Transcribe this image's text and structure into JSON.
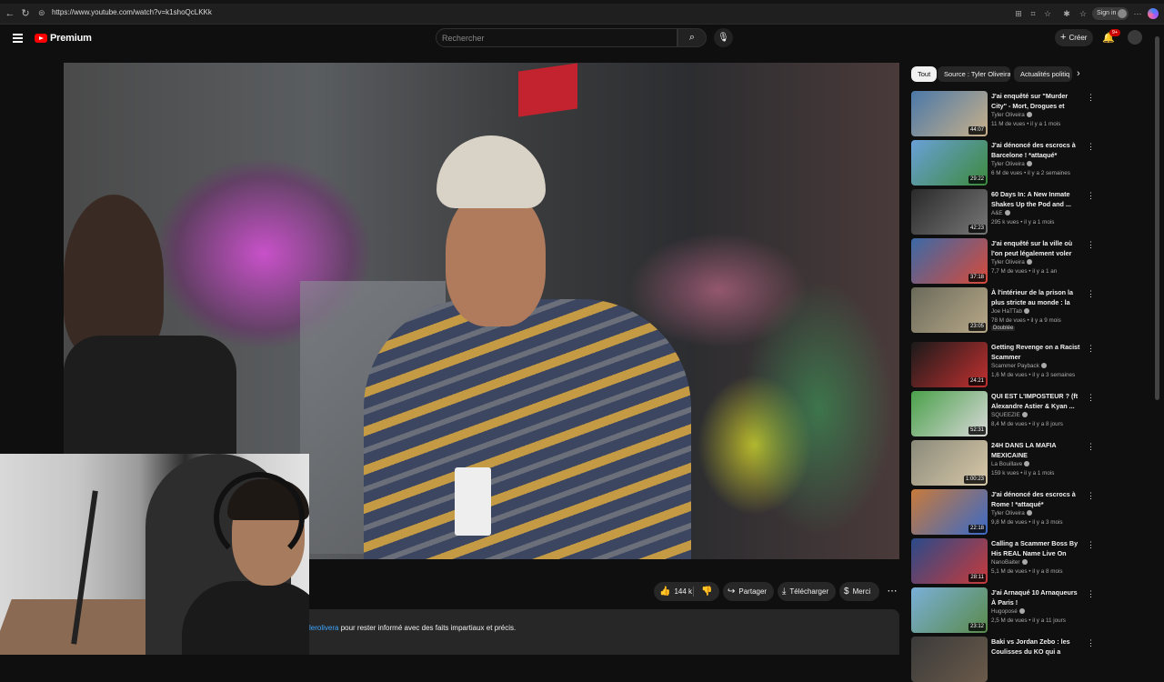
{
  "browser": {
    "url": "https://www.youtube.com/watch?v=k1shoQcLKKk",
    "signin_label": "Sign in"
  },
  "header": {
    "logo_text": "Premium",
    "search_placeholder": "Rechercher",
    "create_label": "Créer",
    "notification_count": "9+"
  },
  "actions": {
    "likes": "144 k",
    "share": "Partager",
    "download": "Télécharger",
    "thanks": "Merci"
  },
  "description": {
    "link": "lerolivera",
    "text": " pour rester informé avec des faits impartiaux et précis."
  },
  "chips": [
    {
      "label": "Tout"
    },
    {
      "label": "Source : Tyler Oliveira"
    },
    {
      "label": "Actualités politiq"
    }
  ],
  "recommendations": [
    {
      "title": "J'ai enquêté sur \"Murder City\" - Mort, Drogues et Tueurs en ...",
      "channel": "Tyler Oliveira",
      "meta": "11 M de vues • il y a 1 mois",
      "duration": "44:07",
      "color1": "#4a78a8",
      "color2": "#c8b08a"
    },
    {
      "title": "J'ai dénoncé des escrocs à Barcelone ! *attaqué*",
      "channel": "Tyler Oliveira",
      "meta": "6 M de vues • il y a 2 semaines",
      "duration": "29:22",
      "color1": "#6aa0d8",
      "color2": "#3c8a3c"
    },
    {
      "title": "60 Days In: A New Inmate Shakes Up the Pod and ...",
      "channel": "A&E",
      "meta": "295 k vues • il y a 1 mois",
      "duration": "42:23",
      "color1": "#2a2a2a",
      "color2": "#777777"
    },
    {
      "title": "J'ai enquêté sur la ville où l'on peut légalement voler des ...",
      "channel": "Tyler Oliveira",
      "meta": "7,7 M de vues • il y a 1 an",
      "duration": "37:18",
      "color1": "#3a6aa8",
      "color2": "#d84a3a"
    },
    {
      "title": "À l'intérieur de la prison la plus stricte au monde : la guerre ...",
      "channel": "Joe HaTTab",
      "meta": "78 M de vues • il y a 9 mois",
      "duration": "23:05",
      "tag": "Doublée",
      "color1": "#6a6a5a",
      "color2": "#b8a888"
    },
    {
      "title": "Getting Revenge on a Racist Scammer",
      "channel": "Scammer Payback",
      "meta": "1,6 M de vues • il y a 3 semaines",
      "duration": "24:21",
      "color1": "#1a1a1a",
      "color2": "#c23030"
    },
    {
      "title": "QUI EST L'IMPOSTEUR ? (ft Alexandre Astier & Kyan ...",
      "channel": "SQUEEZIE",
      "meta": "8,4 M de vues • il y a 8 jours",
      "duration": "52:31",
      "color1": "#4aa04a",
      "color2": "#d8d8d8"
    },
    {
      "title": "24H DANS LA MAFIA MEXICAINE",
      "channel": "La Bouillave",
      "meta": "159 k vues • il y a 1 mois",
      "duration": "1:00:23",
      "color1": "#8a8a7a",
      "color2": "#d8c8a8"
    },
    {
      "title": "J'ai dénoncé des escrocs à Rome ! *attaqué*",
      "channel": "Tyler Oliveira",
      "meta": "9,8 M de vues • il y a 3 mois",
      "duration": "22:18",
      "color1": "#c87a3a",
      "color2": "#3a6ac8"
    },
    {
      "title": "Calling a Scammer Boss By His REAL Name Live On CCTV!",
      "channel": "NanoBaiter",
      "meta": "5,1 M de vues • il y a 8 mois",
      "duration": "28:11",
      "color1": "#2a4a8a",
      "color2": "#c83a3a"
    },
    {
      "title": "J'ai Arnaqué 10 Arnaqueurs À Paris !",
      "channel": "Hugoposé",
      "meta": "2,5 M de vues • il y a 11 jours",
      "duration": "23:12",
      "color1": "#7ab0d8",
      "color2": "#5a8a4a"
    },
    {
      "title": "Baki vs Jordan Zebo : les Coulisses du KO qui a choqué ...",
      "channel": "",
      "meta": "",
      "duration": "",
      "color1": "#3a3a3a",
      "color2": "#6a5a4a"
    }
  ]
}
